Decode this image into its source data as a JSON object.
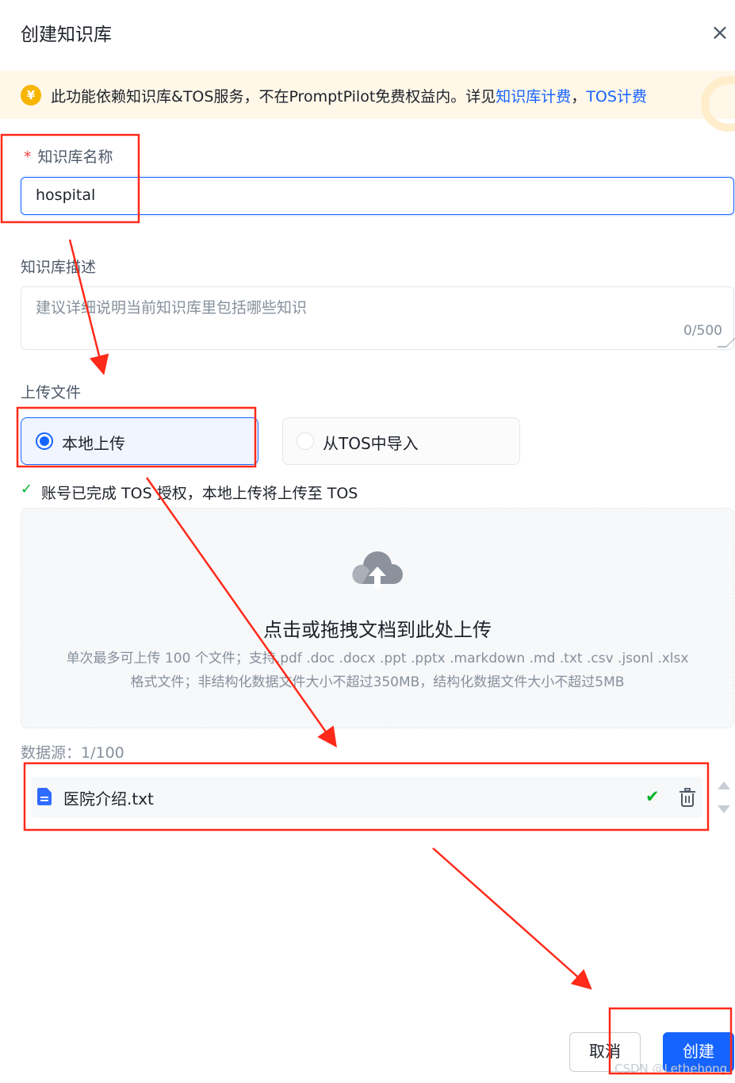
{
  "dialog": {
    "title": "创建知识库",
    "close_symbol": "×"
  },
  "banner": {
    "coin_symbol": "¥",
    "text": "此功能依赖知识库&TOS服务，不在PromptPilot免费权益内。详见",
    "link1": "知识库计费",
    "separator": "，",
    "link2": "TOS计费"
  },
  "form": {
    "name": {
      "required_mark": "*",
      "label": "知识库名称",
      "value": "hospital"
    },
    "description": {
      "label": "知识库描述",
      "placeholder": "建议详细说明当前知识库里包括哪些知识",
      "counter": "0/500"
    },
    "upload": {
      "label": "上传文件",
      "options": [
        {
          "label": "本地上传",
          "selected": true
        },
        {
          "label": "从TOS中导入",
          "selected": false
        }
      ],
      "auth_check": "✓",
      "auth_notice": "账号已完成 TOS 授权，本地上传将上传至 TOS",
      "dropzone": {
        "icon": "cloud-upload-icon",
        "title": "点击或拖拽文档到此处上传",
        "hint": "单次最多可上传 100 个文件；支持.pdf .doc .docx .ppt .pptx .markdown .md .txt .csv .jsonl .xlsx格式文件；非结构化数据文件大小不超过350MB，结构化数据文件大小不超过5MB"
      }
    },
    "datasource": {
      "label": "数据源：1/100",
      "files": [
        {
          "name": "医院介绍.txt",
          "status_symbol": "✔",
          "status": "success"
        }
      ]
    }
  },
  "footer": {
    "cancel_label": "取消",
    "create_label": "创建"
  },
  "watermark": "CSDN @Lethehong",
  "colors": {
    "primary": "#1664ff",
    "success": "#00b42a",
    "danger": "#f53f3f",
    "banner_bg": "#fff7e8",
    "annotation": "#ff2a1a"
  }
}
